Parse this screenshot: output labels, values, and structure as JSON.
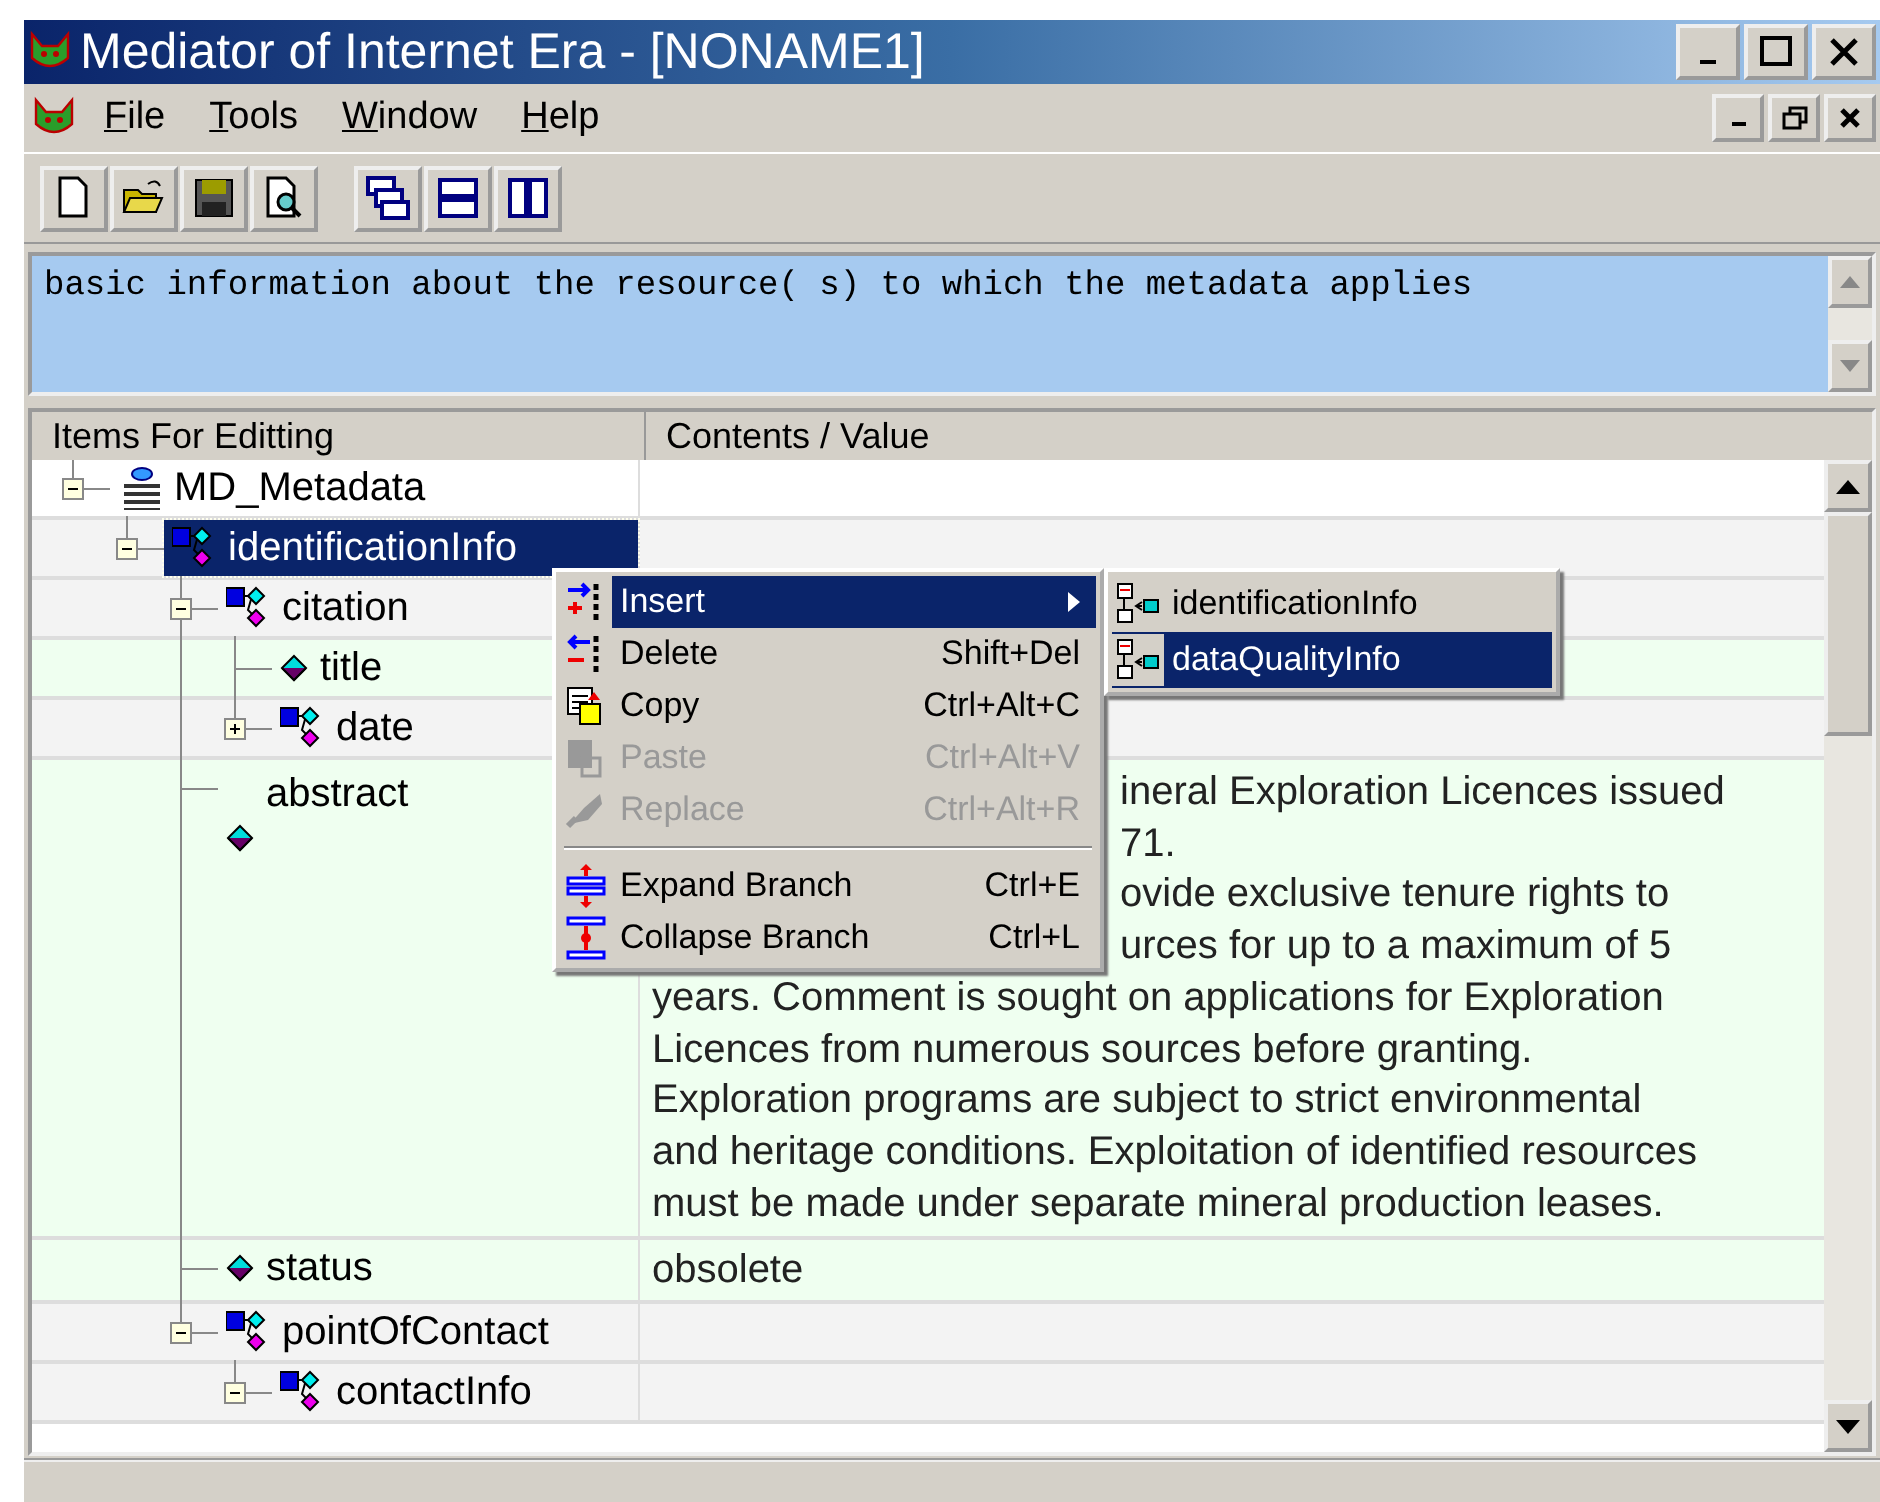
{
  "window": {
    "title": "Mediator of Internet Era - [NONAME1]"
  },
  "menu_bar": [
    {
      "label": "File"
    },
    {
      "label": "Tools"
    },
    {
      "label": "Window"
    },
    {
      "label": "Help"
    }
  ],
  "toolbar": {
    "groups": [
      [
        {
          "kind": "new"
        },
        {
          "kind": "open"
        },
        {
          "kind": "save"
        },
        {
          "kind": "preview"
        }
      ],
      [
        {
          "kind": "cascade"
        },
        {
          "kind": "tile-horizontal"
        },
        {
          "kind": "tile-vertical"
        }
      ]
    ]
  },
  "description": {
    "value": "basic information about the resource( s) to which the metadata applies"
  },
  "tree": {
    "columns": [
      "Items For Editting",
      "Contents / Value"
    ],
    "nodes": [
      {
        "label": "MD_Metadata",
        "kind": "root",
        "expanded": true,
        "selected": false,
        "children": [
          {
            "label": "identificationInfo",
            "kind": "branch",
            "expanded": true,
            "selected": true,
            "children": [
              {
                "label": "citation",
                "kind": "branch",
                "expanded": true,
                "selected": false,
                "children": [
                  {
                    "label": "title",
                    "kind": "leaf",
                    "selected": false
                  },
                  {
                    "label": "date",
                    "kind": "branch",
                    "expanded": false,
                    "selected": false
                  }
                ]
              },
              {
                "label": "abstract",
                "kind": "leaf",
                "selected": false,
                "value_lines": [
                  {
                    "text": "ineral Exploration Licences issued",
                    "partial": true
                  },
                  {
                    "text": "71.",
                    "partial": true
                  },
                  {
                    "text": "ovide exclusive tenure rights to",
                    "partial": true
                  },
                  {
                    "text": "urces for up to a maximum of 5",
                    "partial": true
                  },
                  {
                    "text": "years. Comment is sought on applications for Exploration",
                    "partial": false
                  },
                  {
                    "text": "Licences from numerous sources before granting.",
                    "partial": false
                  },
                  {
                    "text": "Exploration programs are subject to strict environmental",
                    "partial": false
                  },
                  {
                    "text": "and heritage conditions. Exploitation of identified resources",
                    "partial": false
                  },
                  {
                    "text": "must be made under separate mineral production leases.",
                    "partial": false
                  }
                ]
              },
              {
                "label": "status",
                "kind": "leaf",
                "selected": false,
                "value": "obsolete"
              },
              {
                "label": "pointOfContact",
                "kind": "branch",
                "expanded": true,
                "selected": false,
                "children": [
                  {
                    "label": "contactInfo",
                    "kind": "branch",
                    "expanded": true,
                    "selected": false
                  }
                ]
              }
            ]
          }
        ]
      }
    ]
  },
  "context_menu": {
    "items": [
      {
        "kind": "insert",
        "label": "Insert",
        "submenu": true,
        "selected": true,
        "disabled": false
      },
      {
        "kind": "delete",
        "label": "Delete",
        "shortcut": "Shift+Del",
        "selected": false,
        "disabled": false
      },
      {
        "kind": "copy",
        "label": "Copy",
        "shortcut": "Ctrl+Alt+C",
        "selected": false,
        "disabled": false
      },
      {
        "kind": "paste",
        "label": "Paste",
        "shortcut": "Ctrl+Alt+V",
        "selected": false,
        "disabled": true
      },
      {
        "kind": "replace",
        "label": "Replace",
        "shortcut": "Ctrl+Alt+R",
        "selected": false,
        "disabled": true
      },
      {
        "kind": "separator"
      },
      {
        "kind": "expand",
        "label": "Expand Branch",
        "shortcut": "Ctrl+E",
        "selected": false,
        "disabled": false
      },
      {
        "kind": "collapse",
        "label": "Collapse Branch",
        "shortcut": "Ctrl+L",
        "selected": false,
        "disabled": false
      }
    ]
  },
  "submenu": {
    "items": [
      {
        "label": "identificationInfo",
        "selected": false
      },
      {
        "label": "dataQualityInfo",
        "selected": true
      }
    ]
  }
}
